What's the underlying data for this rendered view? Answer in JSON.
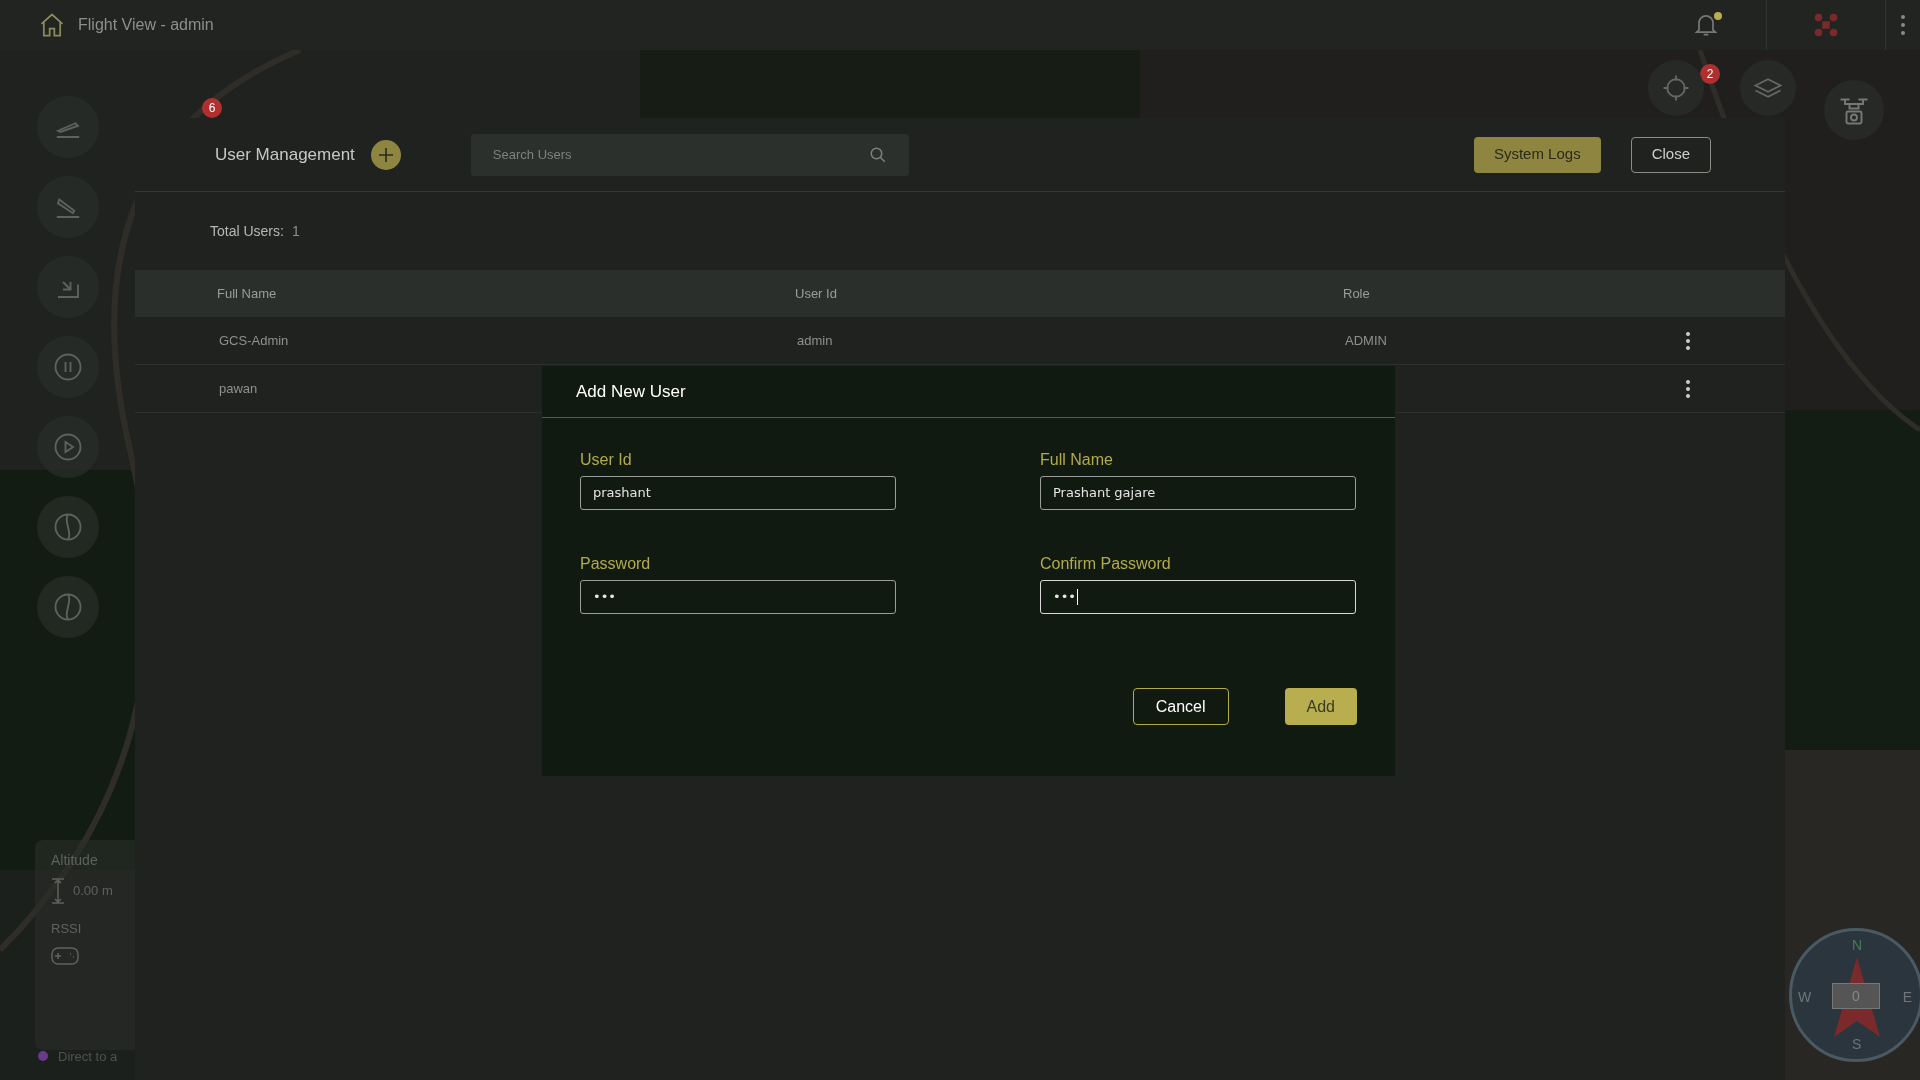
{
  "top_bar": {
    "title": "Flight View - admin",
    "notification_dot": true
  },
  "map": {
    "markers": [
      {
        "label": "6",
        "color": "#b03030"
      },
      {
        "label": "2",
        "color": "#b03030"
      }
    ],
    "telemetry": [
      {
        "label": "Altitude",
        "value": "0.00 m"
      },
      {
        "label": "RSSI"
      }
    ],
    "mode": {
      "label": "Direct to a",
      "color": "#6a3a8a"
    },
    "compass": {
      "north": "N",
      "east": "E",
      "south": "S",
      "west": "W",
      "heading": "0"
    }
  },
  "panel": {
    "title": "User Management",
    "search": {
      "placeholder": "Search Users"
    },
    "buttons": [
      {
        "label": "System Logs",
        "kind": "primary"
      },
      {
        "label": "Close",
        "kind": "outline"
      }
    ],
    "total": {
      "label": "Total Users:",
      "value": "1"
    },
    "table": {
      "columns": [
        "Full Name",
        "User Id",
        "Role"
      ],
      "rows": [
        {
          "cells": [
            "GCS-Admin",
            "admin",
            "ADMIN"
          ]
        },
        {
          "cells": [
            "pawan"
          ]
        }
      ]
    }
  },
  "dialog": {
    "title": "Add New User",
    "fields": [
      {
        "label": "User Id",
        "value": "prashant",
        "focused": false
      },
      {
        "label": "Full Name",
        "value": "Prashant gajare",
        "focused": false
      },
      {
        "label": "Password",
        "value": "•••",
        "focused": false
      },
      {
        "label": "Confirm Password",
        "value": "•••",
        "focused": true
      }
    ],
    "buttons": [
      {
        "label": "Cancel",
        "kind": "outline"
      },
      {
        "label": "Add",
        "kind": "primary"
      }
    ]
  }
}
